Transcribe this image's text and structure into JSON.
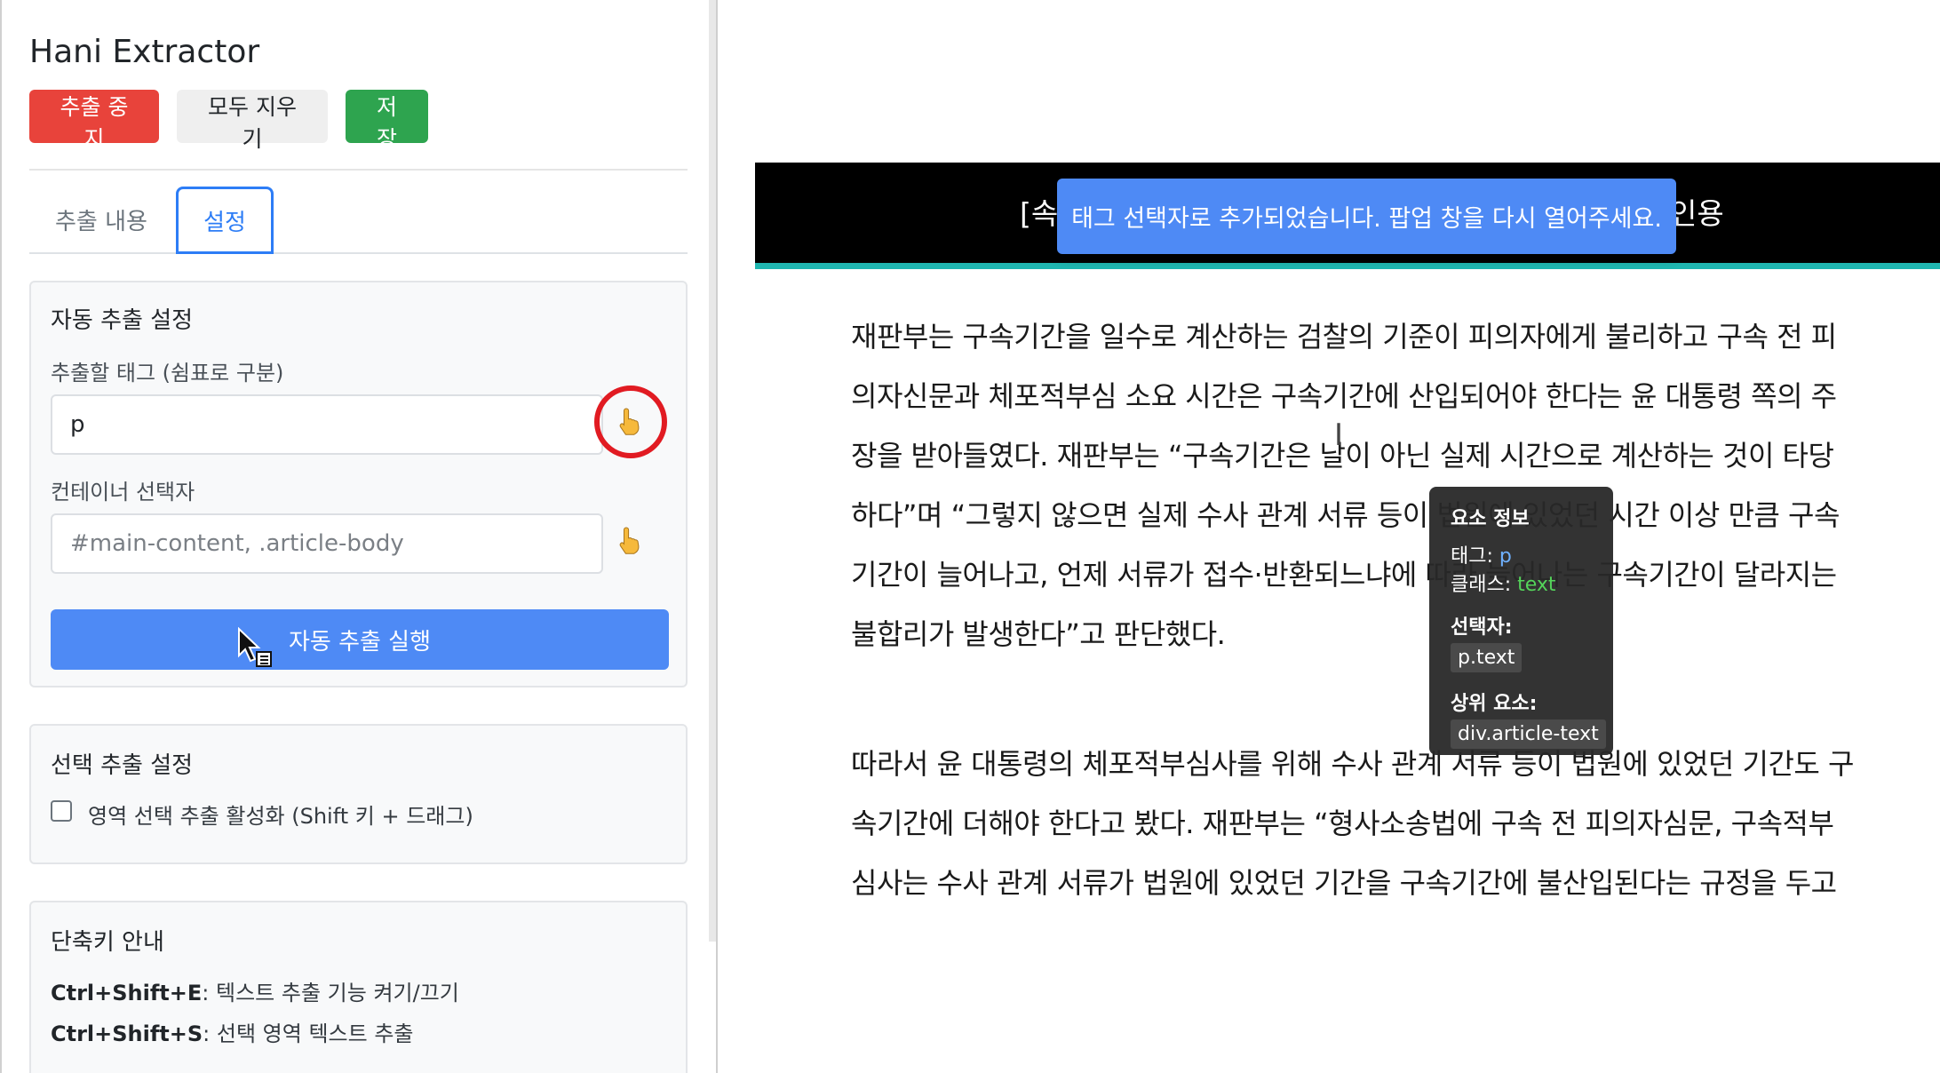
{
  "popup": {
    "app_title": "Hani Extractor",
    "toolbar": {
      "stop_label": "추출 중지",
      "clear_label": "모두 지우기",
      "save_label": "저장"
    },
    "tabs": {
      "content": "추출 내용",
      "settings": "설정",
      "active": "settings"
    },
    "auto_section": {
      "title": "자동 추출 설정",
      "tags_label": "추출할 태그 (쉼표로 구분)",
      "tags_value": "p",
      "container_label": "컨테이너 선택자",
      "container_placeholder": "#main-content, .article-body",
      "run_label": "자동 추출 실행"
    },
    "selection_section": {
      "title": "선택 추출 설정",
      "checkbox_label": "영역 선택 추출 활성화 (Shift 키 + 드래그)",
      "checkbox_checked": false
    },
    "shortcuts_section": {
      "title": "단축키 안내",
      "items": [
        {
          "keys": "Ctrl+Shift+E",
          "desc": ": 텍스트 추출 기능 켜기/끄기"
        },
        {
          "keys": "Ctrl+Shift+S",
          "desc": ": 선택 영역 텍스트 추출"
        }
      ]
    },
    "icons": {
      "picker": "pointing-hand-icon",
      "cursor": "pointer-cursor"
    },
    "colors": {
      "danger": "#e8433b",
      "success": "#2ea44f",
      "primary": "#4e8af5",
      "highlight_ring": "#e11b22"
    }
  },
  "page": {
    "header_left": "[속",
    "header_right": "인용",
    "toast": "태그 선택자로 추가되었습니다. 팝업 창을 다시 열어주세요.",
    "paragraph1": [
      "재판부는 구속기간을 일수로 계산하는 검찰의 기준이 피의자에게 불리하고 구속 전 피",
      "의자신문과 체포적부심 소요 시간은 구속기간에 산입되어야 한다는 윤 대통령 쪽의 주",
      "장을 받아들였다. 재판부는 “구속기간은 날이 아닌 실제 시간으로 계산하는 것이 타당",
      "하다”며 “그렇지 않으면 실제 수사 관계 서류 등이 법원에 있었던 시간 이상 만큼 구속",
      "기간이 늘어나고, 언제 서류가 접수·반환되느냐에 따라 늘어나는 구속기간이 달라지는",
      "불합리가 발생한다”고 판단했다."
    ],
    "paragraph2": [
      "따라서 윤 대통령의 체포적부심사를 위해 수사 관계 서류 등이 법원에 있었던 기간도 구",
      "속기간에 더해야 한다고 봤다. 재판부는 “형사소송법에 구속 전 피의자심문, 구속적부",
      "심사는 수사 관계 서류가 법원에 있었던 기간을 구속기간에 불산입된다는 규정을 두고"
    ],
    "tooltip": {
      "title": "요소 정보",
      "tag_label": "태그: ",
      "tag_value": "p",
      "class_label": "클래스: ",
      "class_value": "text",
      "selector_label": "선택자:",
      "selector_value": "p.text",
      "parent_label": "상위 요소:",
      "parent_value": "div.article-text"
    },
    "colors": {
      "header_bg": "#000000",
      "header_accent": "#1fb6b0"
    }
  }
}
